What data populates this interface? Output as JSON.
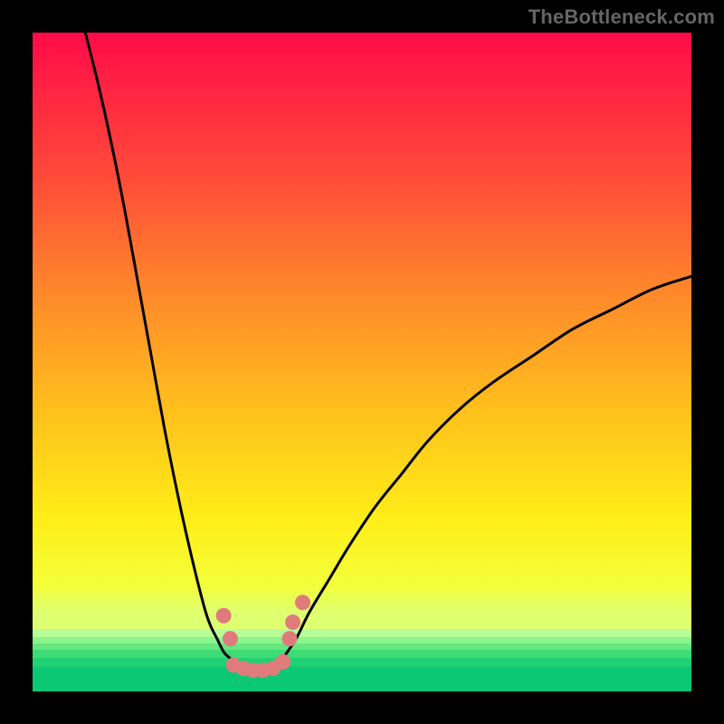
{
  "watermark": {
    "text": "TheBottleneck.com"
  },
  "chart_data": {
    "type": "line",
    "title": "",
    "xlabel": "",
    "ylabel": "",
    "xlim": [
      0,
      100
    ],
    "ylim": [
      0,
      100
    ],
    "grid": false,
    "series": [
      {
        "name": "left-curve",
        "x": [
          8,
          10,
          12,
          14,
          16,
          18,
          20,
          22,
          24,
          26,
          27,
          28,
          29,
          30,
          31,
          32
        ],
        "y": [
          100,
          92,
          83,
          73,
          62,
          51,
          40,
          30,
          21,
          13,
          10,
          8,
          6,
          5,
          4,
          3
        ]
      },
      {
        "name": "right-curve",
        "x": [
          37,
          38,
          40,
          42,
          45,
          48,
          52,
          56,
          60,
          65,
          70,
          76,
          82,
          88,
          94,
          100
        ],
        "y": [
          3,
          5,
          8,
          12,
          17,
          22,
          28,
          33,
          38,
          43,
          47,
          51,
          55,
          58,
          61,
          63
        ]
      }
    ],
    "markers": [
      {
        "name": "left-marker-1",
        "x": 29.0,
        "y": 11.5
      },
      {
        "name": "left-marker-2",
        "x": 30.0,
        "y": 8.0
      },
      {
        "name": "valley-1",
        "x": 30.5,
        "y": 4.0
      },
      {
        "name": "valley-2",
        "x": 32.0,
        "y": 3.5
      },
      {
        "name": "valley-3",
        "x": 33.5,
        "y": 3.2
      },
      {
        "name": "valley-4",
        "x": 35.0,
        "y": 3.2
      },
      {
        "name": "valley-5",
        "x": 36.5,
        "y": 3.5
      },
      {
        "name": "valley-6",
        "x": 38.0,
        "y": 4.5
      },
      {
        "name": "right-marker-1",
        "x": 39.0,
        "y": 8.0
      },
      {
        "name": "right-marker-2",
        "x": 39.5,
        "y": 10.5
      },
      {
        "name": "right-marker-3",
        "x": 41.0,
        "y": 13.5
      }
    ],
    "gradient_stops": [
      {
        "pct": 0,
        "color": "#ff0b49"
      },
      {
        "pct": 22,
        "color": "#ff4b39"
      },
      {
        "pct": 40,
        "color": "#ff8a2a"
      },
      {
        "pct": 58,
        "color": "#ffc21c"
      },
      {
        "pct": 74,
        "color": "#ffee18"
      },
      {
        "pct": 84,
        "color": "#f3ff3a"
      },
      {
        "pct": 88,
        "color": "#deff70"
      },
      {
        "pct": 100,
        "color": "#deff70"
      }
    ],
    "green_bands": [
      {
        "top_pct": 90.5,
        "height_pct": 1.2,
        "color": "#b8ff9a"
      },
      {
        "top_pct": 91.7,
        "height_pct": 1.0,
        "color": "#8cf58b"
      },
      {
        "top_pct": 92.7,
        "height_pct": 1.0,
        "color": "#66e87e"
      },
      {
        "top_pct": 93.7,
        "height_pct": 1.2,
        "color": "#3edc77"
      },
      {
        "top_pct": 94.9,
        "height_pct": 1.4,
        "color": "#1fd074"
      },
      {
        "top_pct": 96.3,
        "height_pct": 3.7,
        "color": "#0ac873"
      }
    ],
    "marker_color": "#e07b7b",
    "curve_color": "#000000",
    "curve_width": 3
  }
}
